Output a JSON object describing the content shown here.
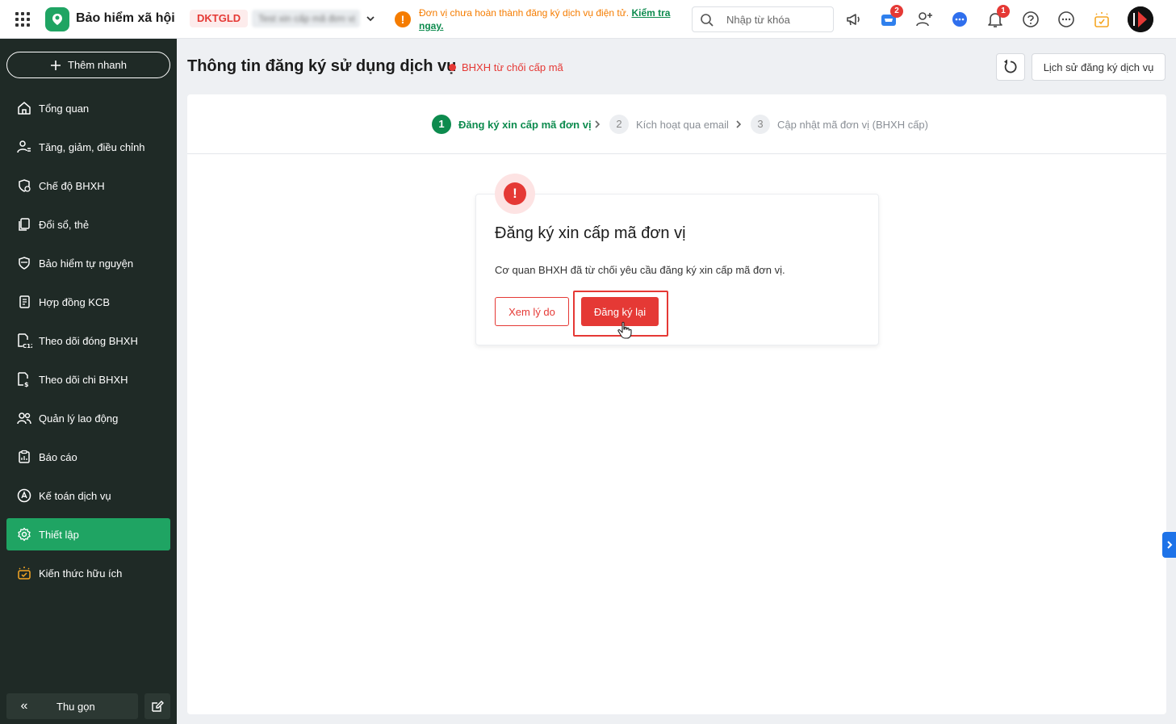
{
  "app": {
    "brand": "Bảo hiểm xã hội"
  },
  "header": {
    "company_code": "DKTGLD",
    "company_name": "Test xin cấp mã đơn vị",
    "warning_text": "Đơn vị chưa hoàn thành đăng ký dịch vụ điện tử.",
    "warning_link": "Kiểm tra ngay.",
    "search_placeholder": "Nhập từ khóa",
    "cart_badge": "2",
    "notification_badge": "1"
  },
  "sidebar": {
    "quick_add": "Thêm nhanh",
    "items": [
      {
        "label": "Tổng quan",
        "icon": "home-icon"
      },
      {
        "label": "Tăng, giảm, điều chỉnh",
        "icon": "user-adjust-icon"
      },
      {
        "label": "Chế độ BHXH",
        "icon": "shield-heart-icon"
      },
      {
        "label": "Đổi sổ, thẻ",
        "icon": "card-swap-icon"
      },
      {
        "label": "Bảo hiểm tự nguyện",
        "icon": "shield-icon"
      },
      {
        "label": "Hợp đồng KCB",
        "icon": "contract-icon"
      },
      {
        "label": "Theo dõi đóng BHXH",
        "icon": "c12-doc-icon"
      },
      {
        "label": "Theo dõi chi BHXH",
        "icon": "payment-doc-icon"
      },
      {
        "label": "Quản lý lao động",
        "icon": "users-icon"
      },
      {
        "label": "Báo cáo",
        "icon": "report-icon"
      },
      {
        "label": "Kế toán dịch vụ",
        "icon": "accounting-icon"
      },
      {
        "label": "Thiết lập",
        "icon": "gear-icon",
        "active": true
      },
      {
        "label": "Kiến thức hữu ích",
        "icon": "bulb-icon"
      }
    ],
    "collapse": "Thu gọn"
  },
  "main": {
    "title": "Thông tin đăng ký sử dụng dịch vụ",
    "status": "BHXH từ chối cấp mã",
    "history_button": "Lịch sử đăng ký dịch vụ",
    "steps": [
      {
        "num": "1",
        "label": "Đăng ký xin cấp mã đơn vị",
        "state": "active"
      },
      {
        "num": "2",
        "label": "Kích hoạt qua email",
        "state": "todo"
      },
      {
        "num": "3",
        "label": "Cập nhật mã đơn vị (BHXH cấp)",
        "state": "todo"
      }
    ],
    "notice": {
      "icon": "!",
      "title": "Đăng ký xin cấp mã đơn vị",
      "description": "Cơ quan BHXH đã từ chối yêu cầu đăng ký xin cấp mã đơn vị.",
      "view_reason": "Xem lý do",
      "reregister": "Đăng ký lại"
    }
  },
  "colors": {
    "brand_green": "#1fa463",
    "step_green": "#0d8b4e",
    "danger": "#e53935",
    "warning": "#f57c00",
    "sidebar_bg": "#1f2a26"
  }
}
